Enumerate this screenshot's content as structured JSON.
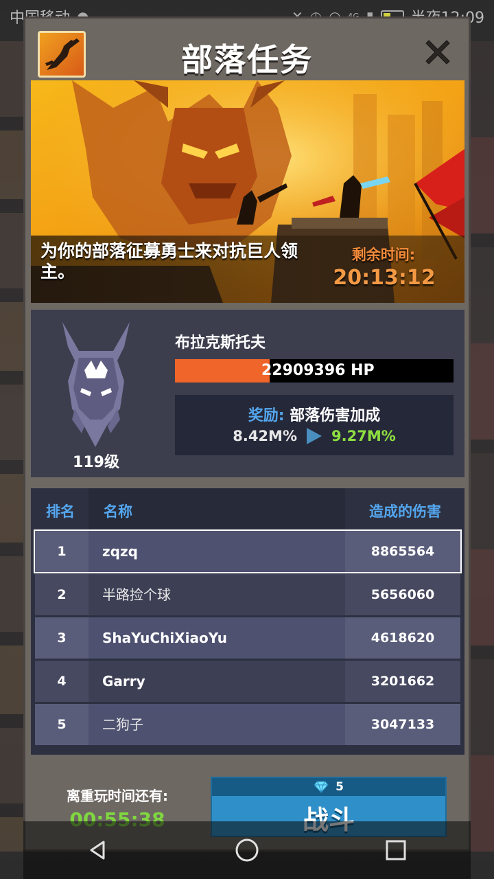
{
  "status_bar": {
    "carrier": "中国移动",
    "time": "半夜12:09",
    "network": "4G"
  },
  "dialog": {
    "title": "部落任务"
  },
  "banner": {
    "description": "为你的部落征募勇士来对抗巨人领主。",
    "timer_label": "剩余时间:",
    "timer_value": "20:13:12"
  },
  "boss": {
    "name": "布拉克斯托夫",
    "level": "119级",
    "hp_text": "22909396 HP",
    "hp_fraction": 0.34,
    "reward_label": "奖励:",
    "reward_text": "部落伤害加成",
    "reward_from": "8.42M%",
    "reward_to": "9.27M%"
  },
  "leaderboard": {
    "headers": {
      "rank": "排名",
      "name": "名称",
      "damage": "造成的伤害"
    },
    "rows": [
      {
        "rank": "1",
        "name": "zqzq",
        "damage": "8865564"
      },
      {
        "rank": "2",
        "name": "半路捡个球",
        "damage": "5656060"
      },
      {
        "rank": "3",
        "name": "ShaYuChiXiaoYu",
        "damage": "4618620"
      },
      {
        "rank": "4",
        "name": "Garry",
        "damage": "3201662"
      },
      {
        "rank": "5",
        "name": "二狗子",
        "damage": "3047133"
      }
    ]
  },
  "footer": {
    "replay_label": "离重玩时间还有:",
    "replay_time": "00:55:38",
    "fight_cost": "5",
    "fight_label": "战斗"
  },
  "colors": {
    "accent_blue": "#54a6ee",
    "hp_orange": "#f0652a",
    "timer_orange": "#f49a45",
    "green_value": "#7fd640"
  }
}
